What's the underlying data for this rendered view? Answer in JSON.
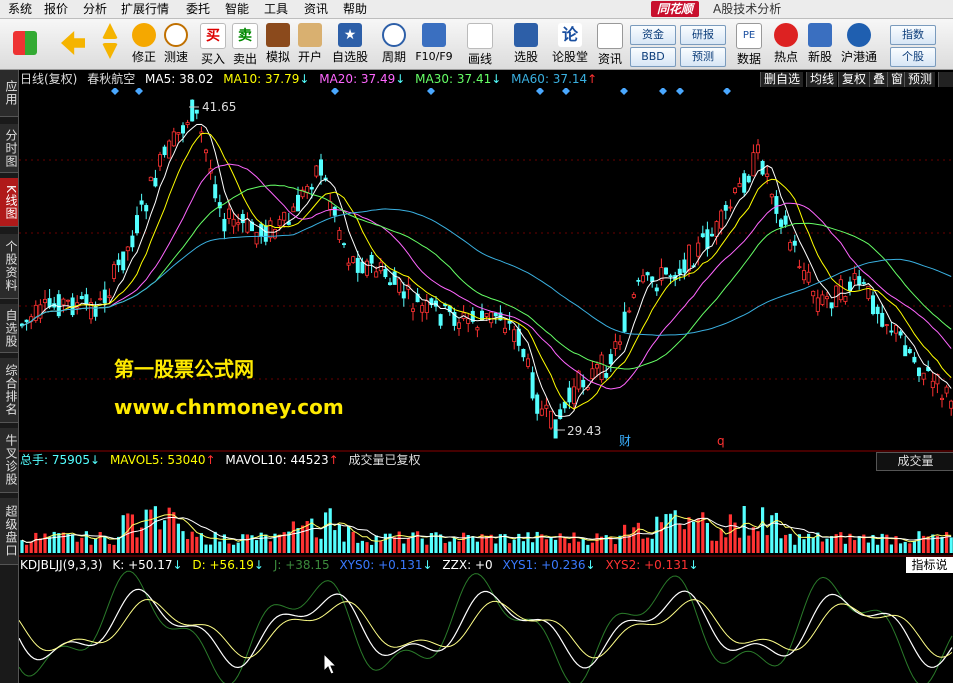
{
  "menu": [
    "系统",
    "报价",
    "分析",
    "扩展行情",
    "委托",
    "智能",
    "工具",
    "资讯",
    "帮助"
  ],
  "brand": "同花顺",
  "brand_sub": "A股技术分析",
  "toolbar": [
    "修正",
    "测速",
    "买入",
    "卖出",
    "模拟",
    "开户",
    "自选股",
    "周期",
    "F10/F9",
    "画线",
    "选股",
    "论股堂",
    "资讯",
    "数据",
    "热点",
    "新股",
    "沪港通"
  ],
  "toolbar_buttons": [
    "资金",
    "研报",
    "BBD",
    "预测",
    "指数",
    "个股"
  ],
  "left_tabs": [
    "应用",
    "分时图",
    "K线图",
    "个股资料",
    "自选股",
    "综合排名",
    "牛叉诊股",
    "超级盘口"
  ],
  "active_tab": "K线图",
  "kline_header": {
    "period": "日线(复权)",
    "stock": "春秋航空",
    "ma5": "MA5: 38.02",
    "ma10": "MA10: 37.79",
    "ma20": "MA20: 37.49",
    "ma30": "MA30: 37.41",
    "ma60": "MA60: 37.14"
  },
  "kline_buttons": [
    "删自选",
    "均线",
    "复权",
    "叠",
    "窗",
    "预测"
  ],
  "price_high": "41.65",
  "price_low": "29.43",
  "event_marks": [
    "财",
    "q"
  ],
  "vol_header": {
    "total": "总手: 75905",
    "mavol5": "MAVOL5: 53040",
    "mavol10": "MAVOL10: 44523",
    "note": "成交量已复权",
    "button": "成交量"
  },
  "kdj_header": {
    "name": "KDJBLJJ(9,3,3)",
    "k": "K: +50.17",
    "d": "D: +56.19",
    "j": "J: +38.15",
    "xys0": "XYS0: +0.131",
    "zzx": "ZZX: +0",
    "xys1": "XYS1: +0.236",
    "xys2": "XYS2: +0.131",
    "button": "指标说明"
  },
  "watermark": [
    "第一股票公式网",
    "www.chnmoney.com"
  ],
  "colors": {
    "up": "#ff3232",
    "down": "#54ffff",
    "ma5": "#ffffff",
    "ma10": "#ffff00",
    "ma20": "#ff66ff",
    "ma30": "#66ff66",
    "ma60": "#3ab0e0"
  }
}
